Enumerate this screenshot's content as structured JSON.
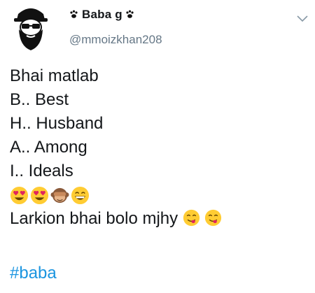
{
  "tweet": {
    "display_name": "Baba g",
    "handle": "@mmoizkhan208",
    "icons": {
      "avatar": "bearded-man-with-sunglasses-avatar",
      "name_decoration": "paw-print-icon",
      "menu": "chevron-down-icon"
    },
    "lines": [
      "Bhai matlab",
      "B.. Best",
      "H.. Husband",
      "A.. Among",
      "I.. Ideals"
    ],
    "emoji_row": [
      "heart-eyes-emoji",
      "heart-eyes-emoji",
      "see-no-evil-monkey-emoji",
      "grinning-face-emoji"
    ],
    "closing_text": "Larkion bhai bolo mjhy",
    "closing_emojis": [
      "yum-face-emoji",
      "yum-face-emoji"
    ],
    "hashtag": "#baba"
  },
  "colors": {
    "text": "#14171a",
    "muted": "#657786",
    "link": "#1b95e0",
    "emoji_yellow": "#ffcc33"
  }
}
